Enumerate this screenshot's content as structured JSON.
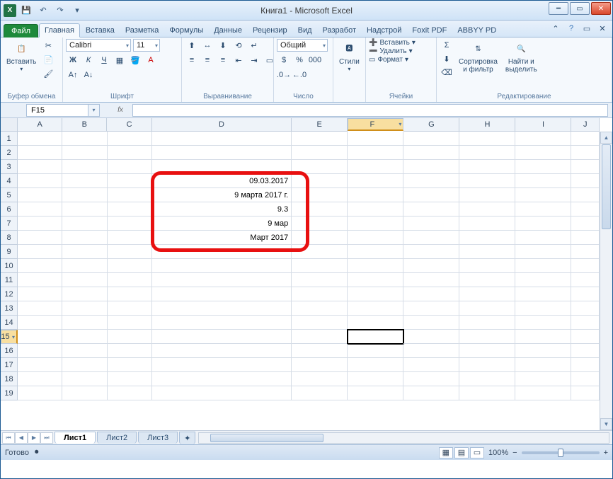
{
  "title": "Книга1  -  Microsoft Excel",
  "tabs": {
    "file": "Файл",
    "list": [
      "Главная",
      "Вставка",
      "Разметка",
      "Формулы",
      "Данные",
      "Рецензир",
      "Вид",
      "Разработ",
      "Надстрой",
      "Foxit PDF",
      "ABBYY PD"
    ]
  },
  "ribbon": {
    "clipboard": {
      "label": "Буфер обмена",
      "paste": "Вставить"
    },
    "font": {
      "label": "Шрифт",
      "name": "Calibri",
      "size": "11"
    },
    "align": {
      "label": "Выравнивание"
    },
    "number": {
      "label": "Число",
      "format": "Общий"
    },
    "styles": {
      "label": "",
      "styles_btn": "Стили"
    },
    "cells": {
      "label": "Ячейки",
      "insert": "Вставить",
      "delete": "Удалить",
      "format": "Формат"
    },
    "editing": {
      "label": "Редактирование",
      "sort": "Сортировка\nи фильтр",
      "find": "Найти и\nвыделить"
    }
  },
  "namebox": "F15",
  "fx": "fx",
  "columns": [
    "A",
    "B",
    "C",
    "D",
    "E",
    "F",
    "G",
    "H",
    "I",
    "J"
  ],
  "rows": [
    "1",
    "2",
    "3",
    "4",
    "5",
    "6",
    "7",
    "8",
    "9",
    "10",
    "11",
    "12",
    "13",
    "14",
    "15",
    "16",
    "17",
    "18",
    "19"
  ],
  "cell_data": {
    "D4": "09.03.2017",
    "D5": "9 марта 2017 г.",
    "D6": "9.3",
    "D7": "9 мар",
    "D8": "Март 2017"
  },
  "active_cell": "F15",
  "sheets": {
    "nav": [
      "⏮",
      "◀",
      "▶",
      "⏭"
    ],
    "list": [
      "Лист1",
      "Лист2",
      "Лист3"
    ]
  },
  "status": {
    "ready": "Готово",
    "zoom": "100%"
  }
}
